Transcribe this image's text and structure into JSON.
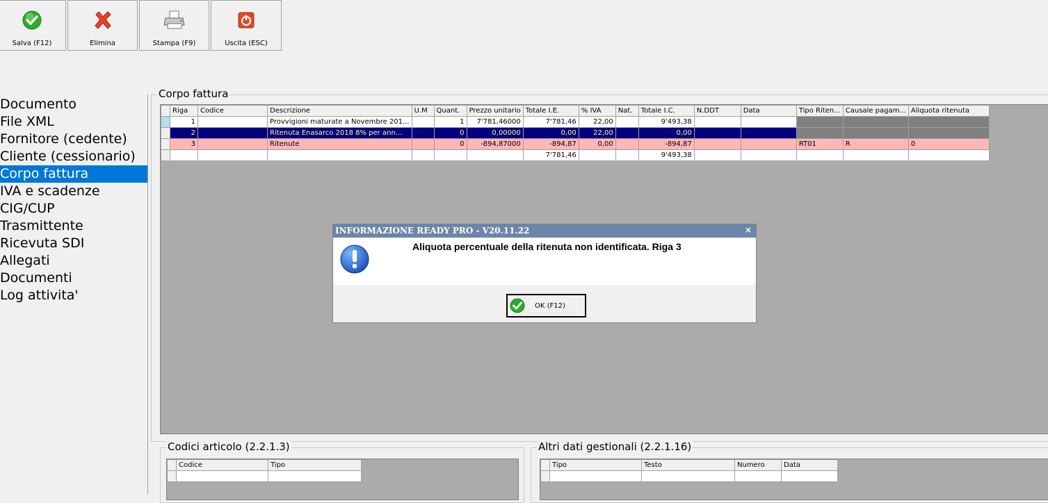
{
  "toolbar": {
    "save_label": "Salva (F12)",
    "delete_label": "Elimina",
    "print_label": "Stampa (F9)",
    "exit_label": "Uscita (ESC)"
  },
  "nav": {
    "items": [
      "Documento",
      "File XML",
      "Fornitore (cedente)",
      "Cliente (cessionario)",
      "Corpo fattura",
      "IVA e scadenze",
      "CIG/CUP",
      "Trasmittente",
      "Ricevuta SDI",
      "Allegati",
      "Documenti",
      "Log attivita'"
    ],
    "selected_index": 4
  },
  "corpo": {
    "title": "Corpo fattura",
    "columns": [
      "Riga",
      "Codice",
      "Descrizione",
      "U.M",
      "Quant.",
      "Prezzo unitario",
      "Totale I.E.",
      "% IVA",
      "Nat.",
      "Totale I.C.",
      "N.DDT",
      "Data",
      "Tipo Riten...",
      "Causale pagam...",
      "Aliquota ritenuta"
    ],
    "rows": [
      [
        "1",
        "",
        "Provvigioni maturate a Novembre 201...",
        "",
        "1",
        "7'781,46000",
        "7'781,46",
        "22,00",
        "",
        "9'493,38",
        "",
        "",
        "",
        "",
        ""
      ],
      [
        "2",
        "",
        "Ritenuta Enasarco  2018 8% per ann...",
        "",
        "0",
        "0,00000",
        "0,00",
        "22,00",
        "",
        "0,00",
        "",
        "",
        "",
        "",
        ""
      ],
      [
        "3",
        "",
        "Ritenute",
        "",
        "0",
        "-894,87000",
        "-894,87",
        "0,00",
        "",
        "-894,87",
        "",
        "",
        "RT01",
        "R",
        "0"
      ]
    ],
    "totals": {
      "totale_ie": "7'781,46",
      "totale_ic": "9'493,38"
    }
  },
  "codici": {
    "title": "Codici articolo (2.2.1.3)",
    "columns": [
      "Codice",
      "Tipo"
    ]
  },
  "altri": {
    "title": "Altri dati gestionali (2.2.1.16)",
    "columns": [
      "Tipo",
      "Testo",
      "Numero",
      "Data"
    ]
  },
  "dialog": {
    "title": "INFORMAZIONE READY PRO - V20.11.22",
    "close": "×",
    "message": "Aliquota percentuale della ritenuta non identificata. Riga 3",
    "ok_label": "OK (F12)"
  },
  "colors": {
    "selected_row": "#000080",
    "selected_row_text": "#ffff80",
    "error_row": "#ffb6b6",
    "nav_selected": "#0078d7",
    "dialog_title": "#6d85a8"
  }
}
